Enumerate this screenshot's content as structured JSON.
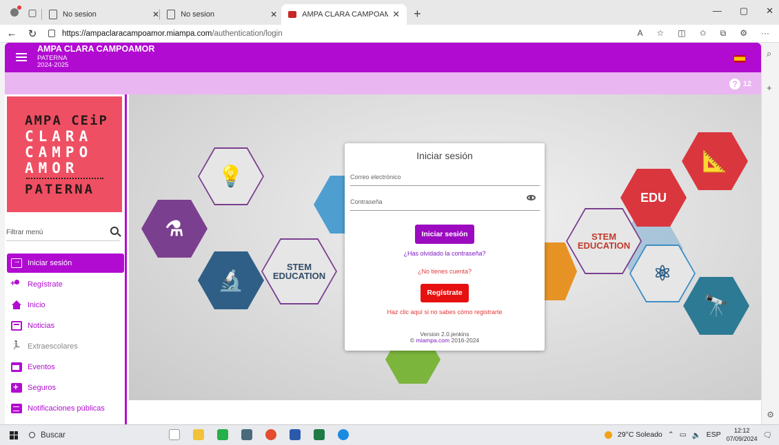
{
  "browser": {
    "tabs": [
      {
        "title": "No sesion",
        "active": false
      },
      {
        "title": "No sesion",
        "active": false
      },
      {
        "title": "AMPA CLARA CAMPOAMOR",
        "active": true
      }
    ],
    "url_host": "https://ampaclaracampoamor.miampa.com",
    "url_path": "/authentication/login"
  },
  "app": {
    "title": "AMPA CLARA CAMPOAMOR",
    "city": "PATERNA",
    "year": "2024-2025",
    "help_count": "12"
  },
  "logo": {
    "line1": "AMPA CEiP",
    "line2": "CLARA",
    "line3": "CAMPO",
    "line4": "AMOR",
    "line5": "PATERNA"
  },
  "sidebar": {
    "filter_label": "Filtrar menú",
    "items": [
      {
        "label": "Iniciar sesión"
      },
      {
        "label": "Regístrate"
      },
      {
        "label": "Inicio"
      },
      {
        "label": "Noticias"
      },
      {
        "label": "Extraescolares"
      },
      {
        "label": "Eventos"
      },
      {
        "label": "Seguros"
      },
      {
        "label": "Notificaciones públicas"
      }
    ]
  },
  "hero": {
    "stem_left": "STEM\nEDUCATION",
    "stem_right": "STEM\nEDUCATION",
    "edu_label": "EDU"
  },
  "login": {
    "title": "Iniciar sesión",
    "email_label": "Correo electrónico",
    "password_label": "Contraseña",
    "submit_label": "Iniciar sesión",
    "forgot_link": "¿Has olvidado la contraseña?",
    "no_account": "¿No tienes cuenta?",
    "register_label": "Regístrate",
    "help_link": "Haz clic aquí si no sabes cómo registrarte",
    "version": "Version 2.0.jenkins",
    "copyright_site": "miampa.com",
    "copyright_years": "2016-2024"
  },
  "taskbar": {
    "search_label": "Buscar",
    "weather": "29°C Soleado",
    "lang": "ESP",
    "time": "12:12",
    "date": "07/09/2024"
  },
  "colors": {
    "brand": "#b10bd1",
    "subbar": "#e9b6f2",
    "register": "#e61010"
  }
}
